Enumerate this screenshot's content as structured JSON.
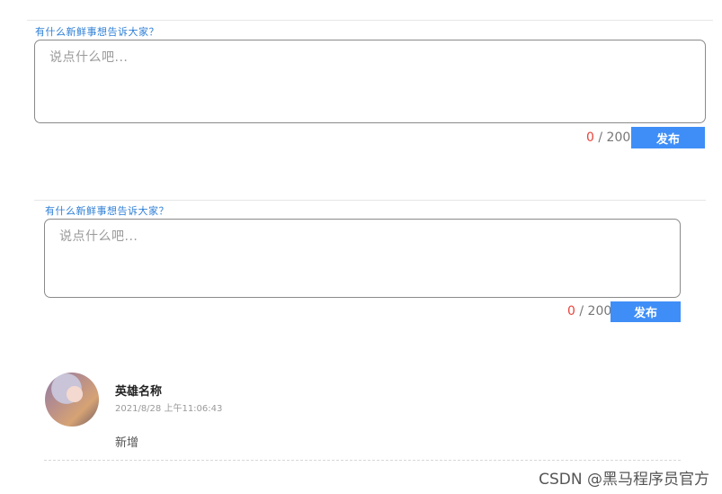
{
  "form1": {
    "prompt": "有什么新鲜事想告诉大家？",
    "placeholder": "说点什么吧...",
    "count_current": "0",
    "count_sep": " / ",
    "count_max": "200",
    "submit_label": "发布"
  },
  "form2": {
    "prompt": "有什么新鲜事想告诉大家？",
    "placeholder": "说点什么吧...",
    "count_current": "0",
    "count_sep": " / ",
    "count_max": "200",
    "submit_label": "发布"
  },
  "comment": {
    "name": "英雄名称",
    "time": "2021/8/28 上午11:06:43",
    "text": "新增"
  },
  "watermark": "CSDN @黑马程序员官方",
  "colors": {
    "accent": "#3f8ef7",
    "prompt": "#2e7fd6",
    "count_current": "#e8453c"
  }
}
